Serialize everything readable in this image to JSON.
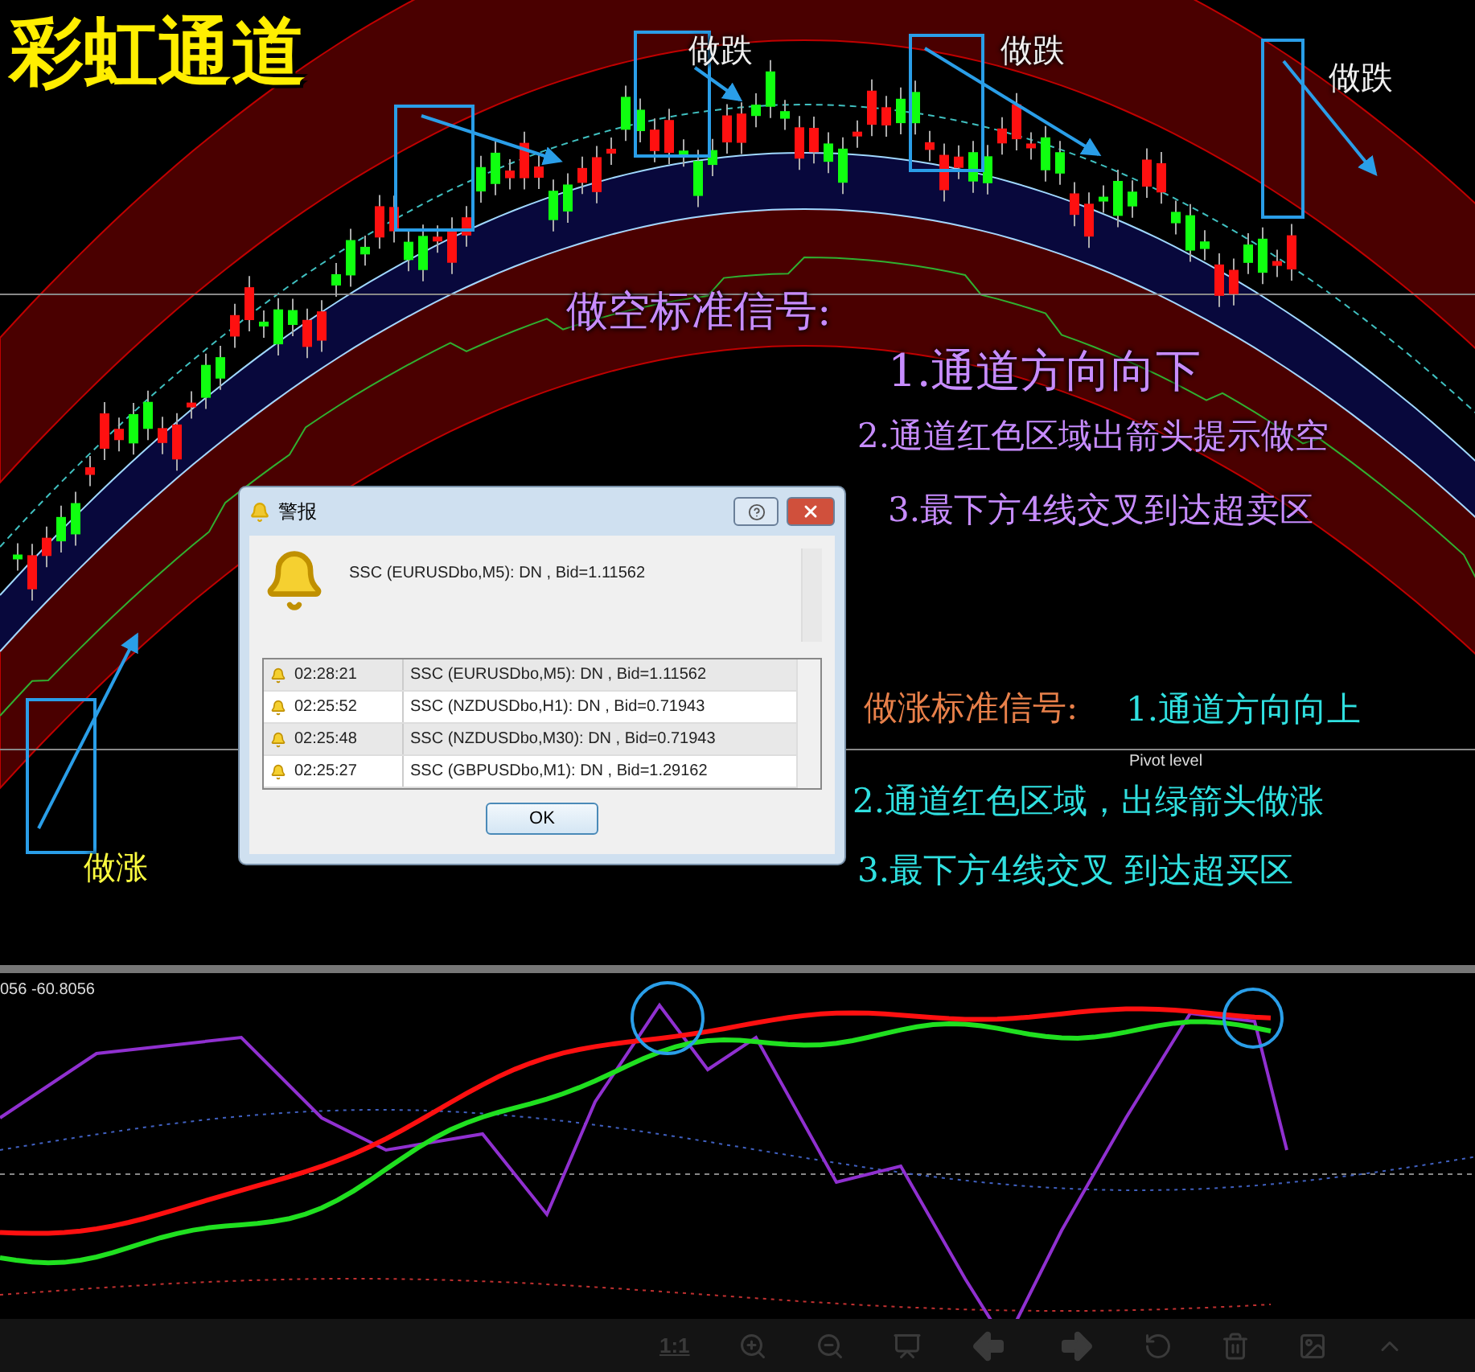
{
  "title": "彩虹通道",
  "chart_notes": [
    {
      "kind": "sell",
      "text": "做跌"
    },
    {
      "kind": "sell",
      "text": "做跌"
    },
    {
      "kind": "sell",
      "text": "做跌"
    },
    {
      "kind": "buy",
      "text": "做涨"
    }
  ],
  "short_signal": {
    "heading": "做空标准信号:",
    "items": [
      "1.通道方向向下",
      "2.通道红色区域出箭头提示做空",
      "3.最下方4线交叉到达超卖区"
    ]
  },
  "long_signal": {
    "heading": "做涨标准信号:",
    "items": [
      "1.通道方向向上",
      "2.通道红色区域，出绿箭头做涨",
      "3.最下方4线交叉 到达超买区"
    ]
  },
  "pivot_label": "Pivot level",
  "alert_dialog": {
    "title": "警报",
    "message": "SSC (EURUSDbo,M5): DN , Bid=1.11562",
    "rows": [
      {
        "time": "02:28:21",
        "text": "SSC (EURUSDbo,M5): DN , Bid=1.11562"
      },
      {
        "time": "02:25:52",
        "text": "SSC (NZDUSDbo,H1): DN , Bid=0.71943"
      },
      {
        "time": "02:25:48",
        "text": "SSC (NZDUSDbo,M30): DN , Bid=0.71943"
      },
      {
        "time": "02:25:27",
        "text": "SSC (GBPUSDbo,M1): DN , Bid=1.29162"
      }
    ],
    "ok_button": "OK"
  },
  "indicator_label": "056 -60.8056",
  "toolbar": {
    "scale_label": "1:1"
  }
}
